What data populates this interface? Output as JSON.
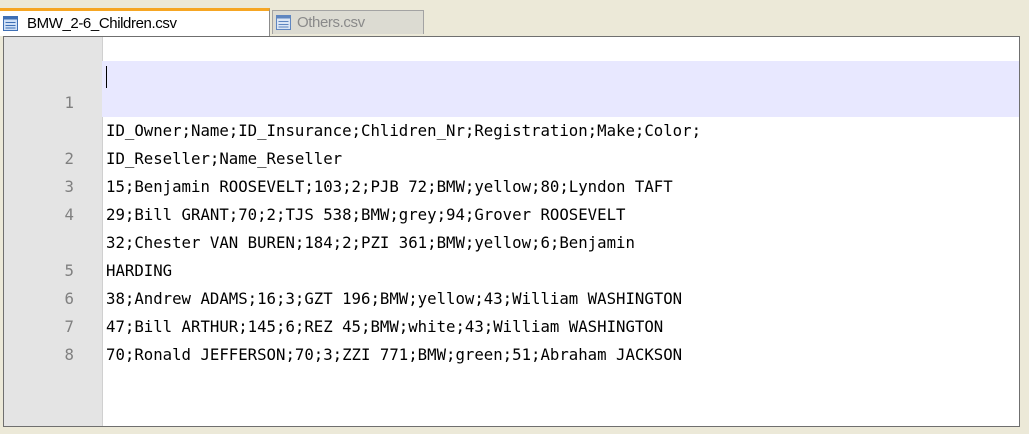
{
  "tabs": [
    {
      "label": "BMW_2-6_Children.csv",
      "active": true
    },
    {
      "label": "Others.csv",
      "active": false
    }
  ],
  "colors": {
    "active_tab_accent": "#f6a623",
    "current_line_highlight": "#e8e8ff",
    "gutter": "#e4e4e4",
    "line_number": "#808080",
    "inactive_tab_text": "#8a8a8a"
  },
  "icons": {
    "tab_file": "document-list-icon"
  },
  "editor": {
    "lines": [
      {
        "number": "1",
        "text": "ID_Owner;Name;ID_Insurance;Chlidren_Nr;Registration;Make;Color;"
      },
      {
        "number": "",
        "text": "ID_Reseller;Name_Reseller"
      },
      {
        "number": "2",
        "text": "15;Benjamin ROOSEVELT;103;2;PJB 72;BMW;yellow;80;Lyndon TAFT"
      },
      {
        "number": "3",
        "text": "29;Bill GRANT;70;2;TJS 538;BMW;grey;94;Grover ROOSEVELT"
      },
      {
        "number": "4",
        "text": "32;Chester VAN BUREN;184;2;PZI 361;BMW;yellow;6;Benjamin"
      },
      {
        "number": "",
        "text": "HARDING"
      },
      {
        "number": "5",
        "text": "38;Andrew ADAMS;16;3;GZT 196;BMW;yellow;43;William WASHINGTON"
      },
      {
        "number": "6",
        "text": "47;Bill ARTHUR;145;6;REZ 45;BMW;white;43;William WASHINGTON"
      },
      {
        "number": "7",
        "text": "70;Ronald JEFFERSON;70;3;ZZI 771;BMW;green;51;Abraham JACKSON"
      },
      {
        "number": "8",
        "text": ""
      }
    ]
  }
}
